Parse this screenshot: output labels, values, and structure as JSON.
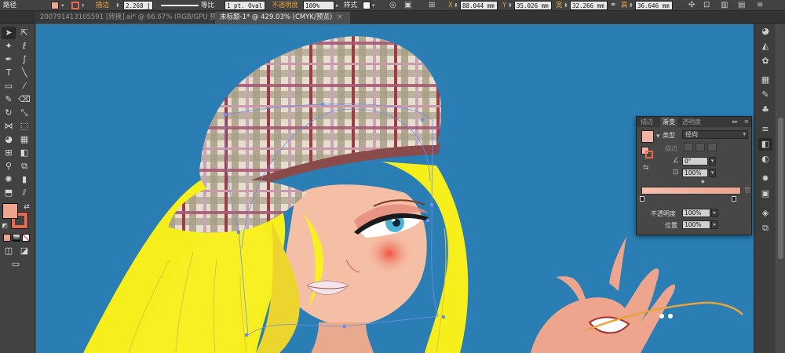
{
  "control_bar": {
    "object_type": "路径",
    "stroke_label": "描边",
    "stroke_weight": "2.268 j",
    "line_profile": "等比",
    "brush": "1 pt. Oval",
    "opacity_label": "不透明度",
    "opacity": "100%",
    "style_label": "样式",
    "x_label": "X",
    "x_value": "88.044 mm",
    "y_label": "Y",
    "y_value": "35.026 mm",
    "w_label": "宽",
    "w_value": "32.266 mm",
    "h_label": "高",
    "h_value": "36.646 mm"
  },
  "tabs": [
    {
      "label": "200791413105591 [转换].ai* @ 66.67% (RGB/GPU 预览)",
      "close": "×",
      "active": false
    },
    {
      "label": "未标题-1* @ 429.03% (CMYK/预览)",
      "close": "×",
      "active": true
    }
  ],
  "gradient_panel": {
    "tabs": [
      "描边",
      "渐变",
      "透明度"
    ],
    "type_label": "类型",
    "type_value": "径向",
    "stroke_label": "描边",
    "angle_value": "0°",
    "aspect_value": "100%",
    "opacity_label": "不透明度",
    "opacity_value": "100%",
    "location_label": "位置",
    "location_value": "100%"
  },
  "colors": {
    "canvas_bg": "#2a7eb4",
    "fill": "#eda58d",
    "stroke": "#e86a4a",
    "accent_orange": "#e8a33a"
  }
}
